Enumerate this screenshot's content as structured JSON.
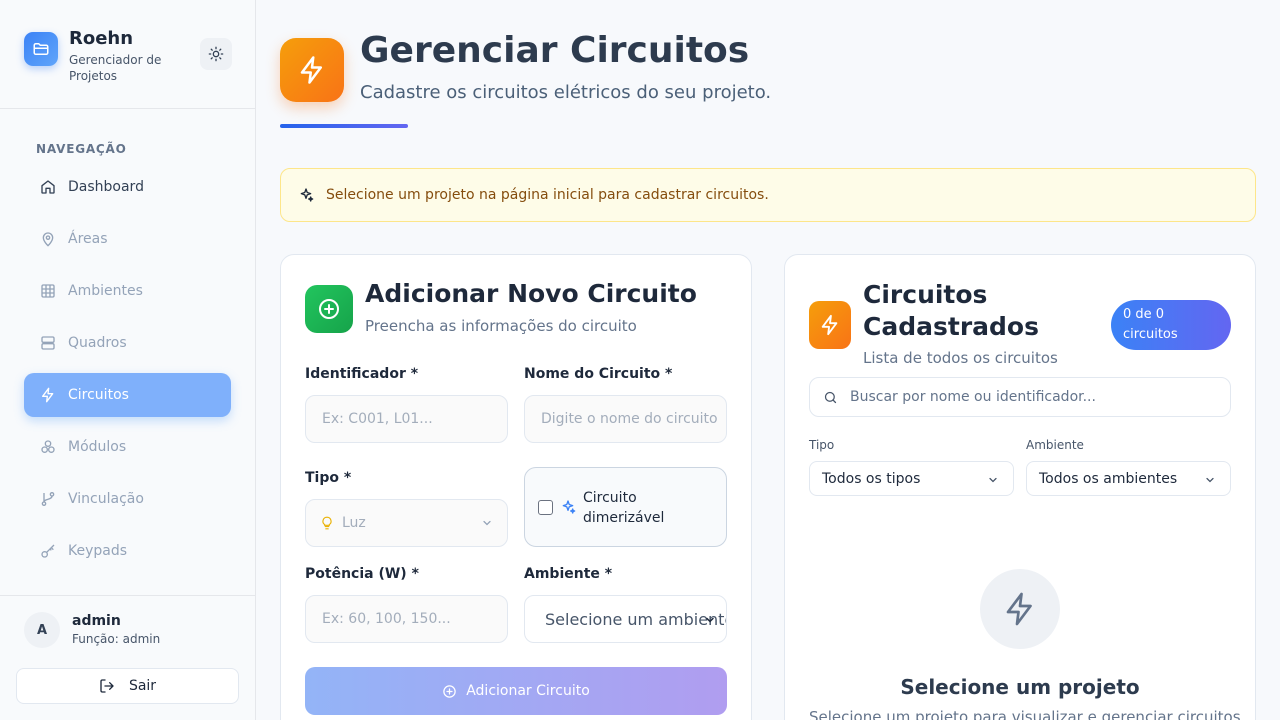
{
  "sidebar": {
    "brand_name": "Roehn",
    "brand_sub": "Gerenciador de Projetos",
    "nav_heading": "NAVEGAÇÃO",
    "items": [
      {
        "label": "Dashboard",
        "icon": "home-icon"
      },
      {
        "label": "Áreas",
        "icon": "map-pin-icon"
      },
      {
        "label": "Ambientes",
        "icon": "grid-icon"
      },
      {
        "label": "Quadros",
        "icon": "server-icon"
      },
      {
        "label": "Circuitos",
        "icon": "zap-icon",
        "active": true
      },
      {
        "label": "Módulos",
        "icon": "boxes-icon"
      },
      {
        "label": "Vinculação",
        "icon": "git-branch-icon"
      },
      {
        "label": "Keypads",
        "icon": "key-icon"
      }
    ],
    "user": {
      "initial": "A",
      "name": "admin",
      "role": "Função: admin"
    },
    "logout_label": "Sair"
  },
  "header": {
    "title": "Gerenciar Circuitos",
    "subtitle": "Cadastre os circuitos elétricos do seu projeto."
  },
  "alert": {
    "text": "Selecione um projeto na página inicial para cadastrar circuitos."
  },
  "form": {
    "title": "Adicionar Novo Circuito",
    "subtitle": "Preencha as informações do circuito",
    "identificador_label": "Identificador *",
    "identificador_placeholder": "Ex: C001, L01...",
    "nome_label": "Nome do Circuito *",
    "nome_placeholder": "Digite o nome do circuito",
    "tipo_label": "Tipo *",
    "tipo_value": "Luz",
    "dimmer_label": "Circuito dimerizável",
    "potencia_label": "Potência (W) *",
    "potencia_placeholder": "Ex: 60, 100, 150...",
    "ambiente_label": "Ambiente *",
    "ambiente_value": "Selecione um ambiente",
    "submit_label": "Adicionar Circuito"
  },
  "list": {
    "title": "Circuitos Cadastrados",
    "subtitle": "Lista de todos os circuitos",
    "count_badge": "0 de 0 circuitos",
    "search_placeholder": "Buscar por nome ou identificador...",
    "tipo_filter_label": "Tipo",
    "tipo_filter_value": "Todos os tipos",
    "ambiente_filter_label": "Ambiente",
    "ambiente_filter_value": "Todos os ambientes",
    "empty_title": "Selecione um projeto",
    "empty_sub": "Selecione um projeto para visualizar e gerenciar circuitos."
  },
  "colors": {
    "accent": "#3b82f6",
    "nav_active": "#7fb0fb",
    "orange": "#f97316",
    "green": "#22c55e",
    "alert_bg": "#fefce8"
  }
}
